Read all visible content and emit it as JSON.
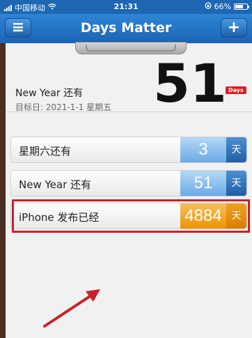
{
  "status_bar": {
    "carrier": "中国移动",
    "time": "21:31",
    "battery": "66%",
    "battery_level": 0.66
  },
  "nav": {
    "title": "Days Matter",
    "menu_icon": "hamburger-menu-icon",
    "add_icon": "plus-icon"
  },
  "hero": {
    "name": "New Year 还有",
    "target_date": "目标日: 2021-1-1 星期五",
    "days": "51",
    "badge": "Days"
  },
  "rows": [
    {
      "label": "星期六还有",
      "days": "3",
      "unit": "天",
      "color": "#6aaae6"
    },
    {
      "label": "New Year 还有",
      "days": "51",
      "unit": "天",
      "color": "#6aaae6"
    },
    {
      "label": "iPhone 发布已经",
      "days": "4884",
      "unit": "天",
      "color": "#ee9400"
    }
  ],
  "colors": {
    "nav_bar": "#1d67b3",
    "highlight": "#c5232a",
    "badge": "#d81c23"
  }
}
